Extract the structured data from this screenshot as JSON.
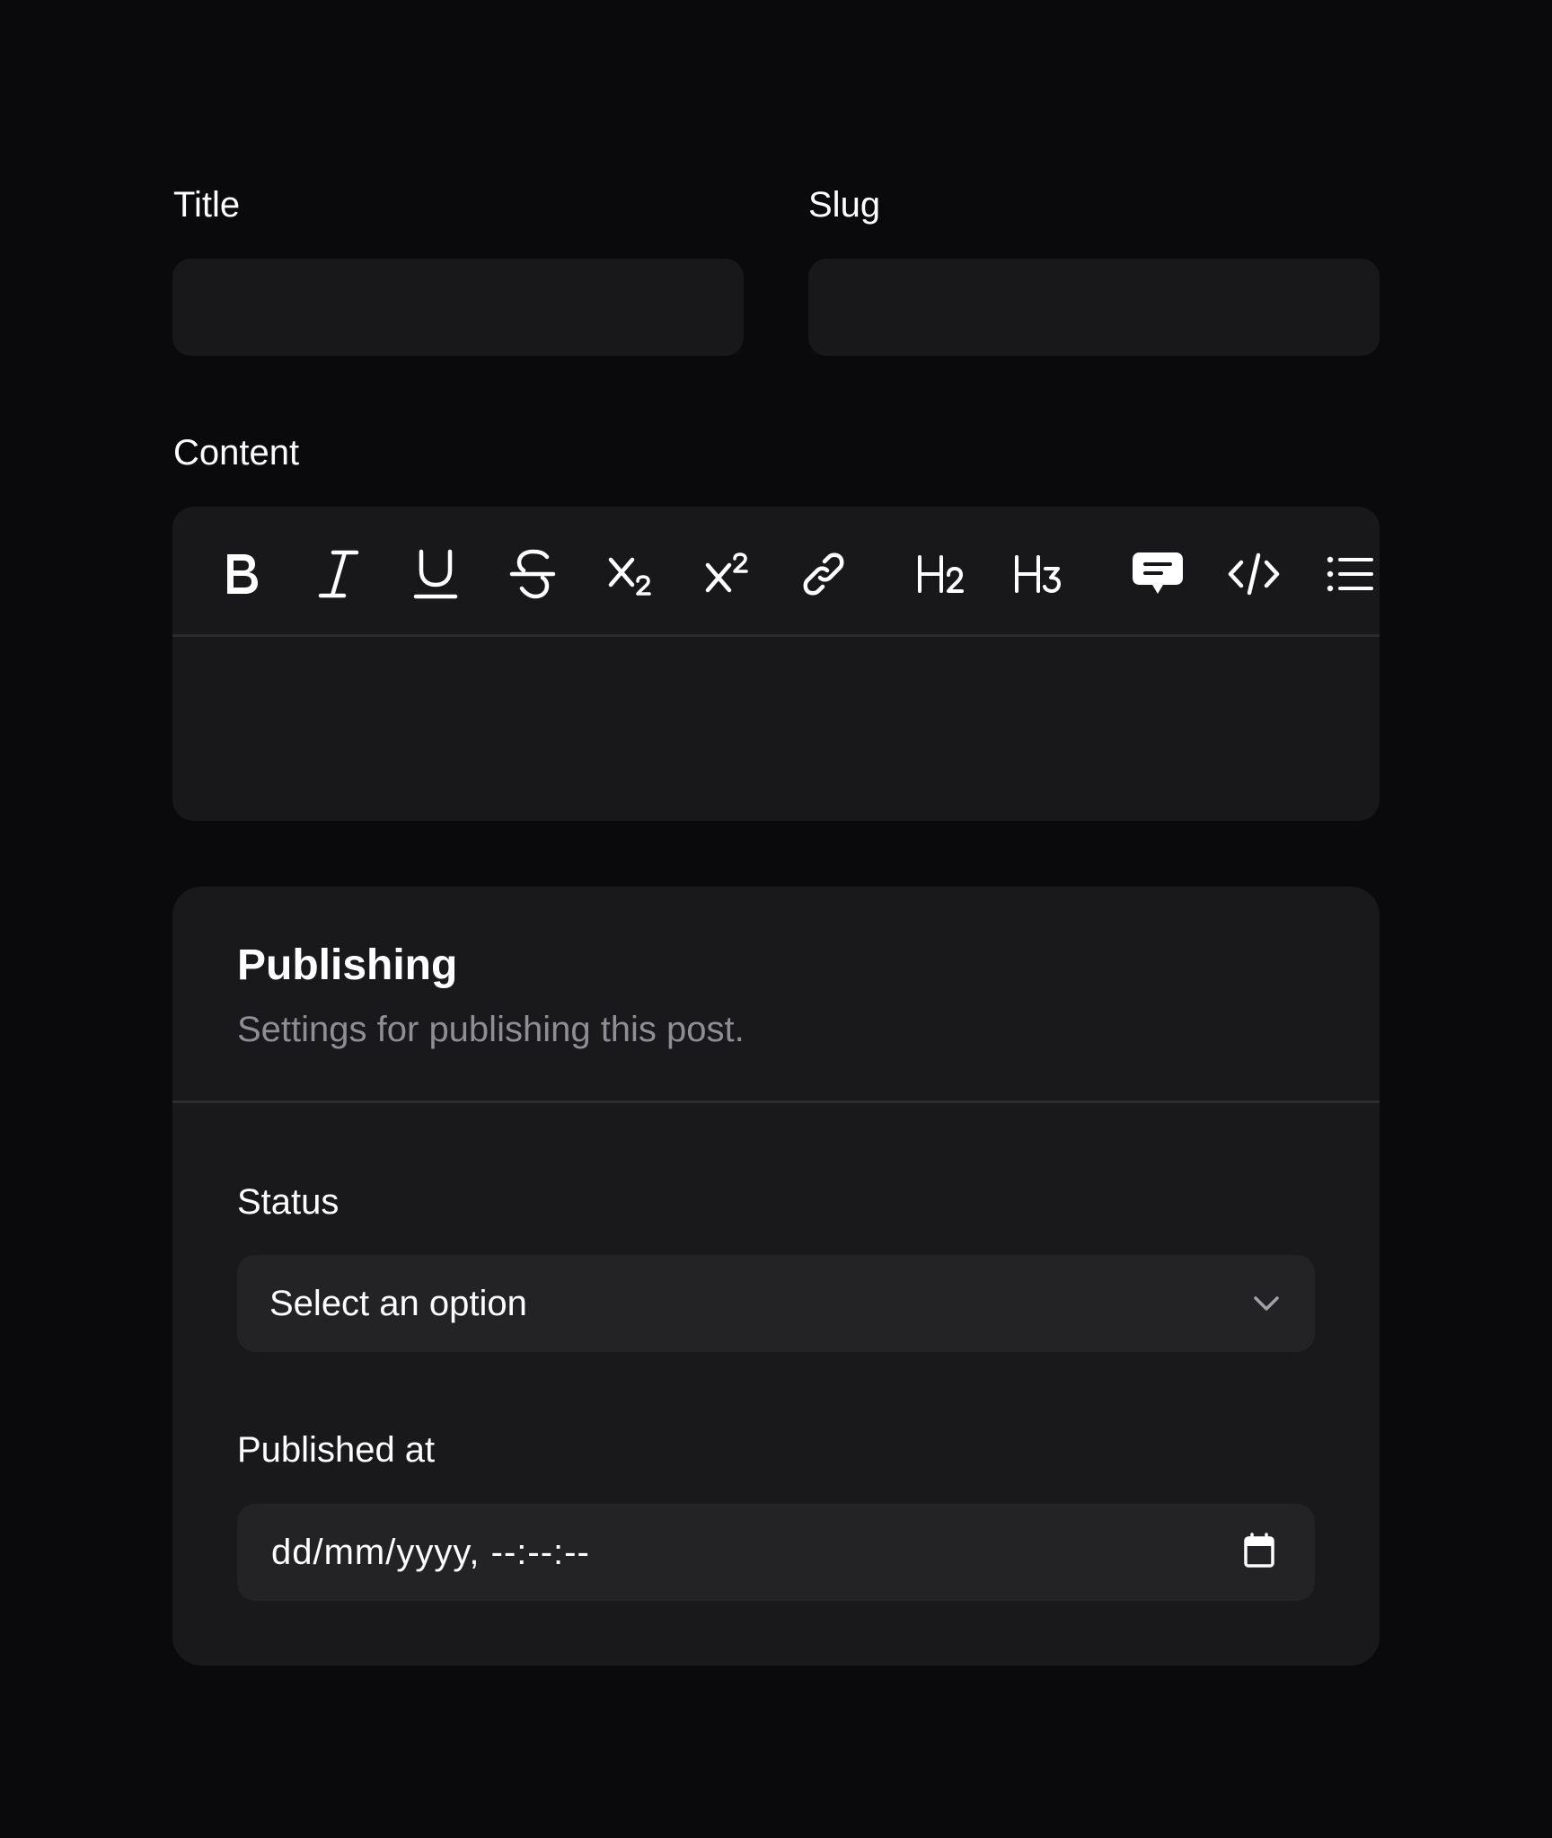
{
  "form": {
    "title_label": "Title",
    "title_value": "",
    "slug_label": "Slug",
    "slug_value": "",
    "content_label": "Content"
  },
  "editor": {
    "toolbar": [
      {
        "name": "bold",
        "icon": "bold-icon"
      },
      {
        "name": "italic",
        "icon": "italic-icon"
      },
      {
        "name": "underline",
        "icon": "underline-icon"
      },
      {
        "name": "strikethrough",
        "icon": "strikethrough-icon"
      },
      {
        "name": "subscript",
        "icon": "subscript-icon"
      },
      {
        "name": "superscript",
        "icon": "superscript-icon"
      },
      {
        "name": "link",
        "icon": "link-icon"
      },
      {
        "name": "heading-2",
        "icon": "h2-icon"
      },
      {
        "name": "heading-3",
        "icon": "h3-icon"
      },
      {
        "name": "blockquote",
        "icon": "speech-bubble-icon"
      },
      {
        "name": "code-block",
        "icon": "code-icon"
      },
      {
        "name": "bullet-list",
        "icon": "bullet-list-icon"
      }
    ],
    "content_value": ""
  },
  "publishing": {
    "title": "Publishing",
    "description": "Settings for publishing this post.",
    "status_label": "Status",
    "status_placeholder": "Select an option",
    "published_at_label": "Published at",
    "published_at_placeholder": "dd/mm/yyyy, --:--:--"
  },
  "colors": {
    "background": "#0a0a0c",
    "input_background": "#18181a",
    "card_background": "#19191b",
    "field_background": "#232326",
    "muted_text": "#8e8e93"
  }
}
